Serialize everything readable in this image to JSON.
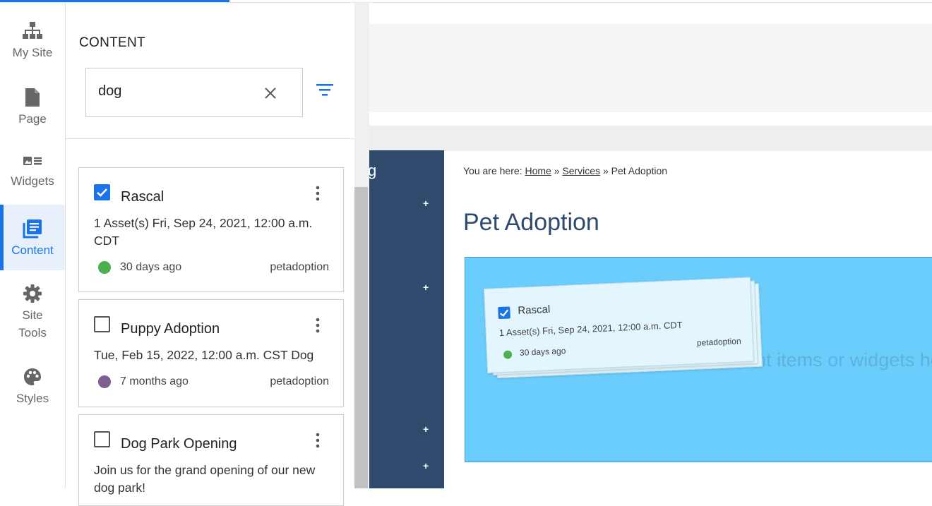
{
  "rail": {
    "items": [
      {
        "label": "My Site",
        "icon": "sitemap-icon"
      },
      {
        "label": "Page",
        "icon": "page-icon"
      },
      {
        "label": "Widgets",
        "icon": "widgets-icon"
      },
      {
        "label": "Content",
        "icon": "content-icon",
        "active": true
      },
      {
        "label": "Site",
        "label2": "Tools",
        "icon": "gear-icon"
      },
      {
        "label": "Styles",
        "icon": "palette-icon"
      }
    ]
  },
  "panel": {
    "title": "CONTENT",
    "search_value": "dog"
  },
  "cards": [
    {
      "title": "Rascal",
      "checked": true,
      "desc": "1 Asset(s) Fri, Sep 24, 2021, 12:00 a.m. CDT",
      "ago": "30 days ago",
      "site": "petadoption",
      "dot_color": "#4caf50"
    },
    {
      "title": "Puppy Adoption",
      "checked": false,
      "desc": "Tue, Feb 15, 2022, 12:00 a.m. CST Dog",
      "ago": "7 months ago",
      "site": "petadoption",
      "dot_color": "#7e5f8f"
    },
    {
      "title": "Dog Park Opening",
      "checked": false,
      "desc": "Join us for the grand opening of our new dog park!"
    }
  ],
  "preview": {
    "nav_letter": "g",
    "plus": "+",
    "breadcrumb": {
      "prefix": "You are here:",
      "home": "Home",
      "services": " Services",
      "sep": "»",
      "current": "Pet Adoption"
    },
    "title": "Pet Adoption",
    "dropzone_hint": "Drag-and-drop content items or widgets here",
    "ghost": {
      "title": "Rascal",
      "desc": "1 Asset(s) Fri, Sep 24, 2021, 12:00 a.m. CDT",
      "ago": "30 days ago",
      "site": "petadoption"
    }
  },
  "colors": {
    "accent": "#1a73e8",
    "nav": "#2f4a6d",
    "dropzone": "#6bcdfb"
  }
}
